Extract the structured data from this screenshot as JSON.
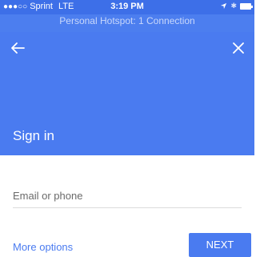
{
  "status_bar": {
    "signal": "●●●○○",
    "carrier": "Sprint",
    "network": "LTE",
    "time": "3:19 PM",
    "bluetooth": "✱"
  },
  "hotspot_banner": "Personal Hotspot: 1 Connection",
  "header": {
    "title": "Sign in"
  },
  "form": {
    "email_label": "Email or phone"
  },
  "footer": {
    "more_options": "More options",
    "next": "NEXT"
  },
  "colors": {
    "brand_blue": "#4a7bf0"
  }
}
